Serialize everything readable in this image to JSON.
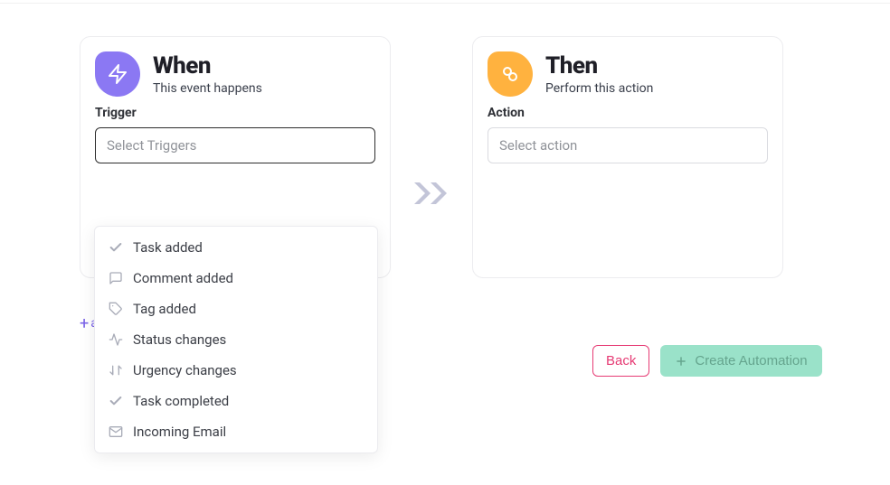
{
  "when": {
    "title": "When",
    "subtitle": "This event happens",
    "field_label": "Trigger",
    "placeholder": "Select Triggers"
  },
  "then": {
    "title": "Then",
    "subtitle": "Perform this action",
    "field_label": "Action",
    "placeholder": "Select action"
  },
  "trigger_options": {
    "task_added": "Task added",
    "comment_added": "Comment added",
    "tag_added": "Tag added",
    "status_changes": "Status changes",
    "urgency_changes": "Urgency changes",
    "task_completed": "Task completed",
    "incoming_email": "Incoming Email"
  },
  "add_condition": {
    "plus": "+",
    "label": "a"
  },
  "buttons": {
    "back": "Back",
    "create": "Create Automation"
  }
}
